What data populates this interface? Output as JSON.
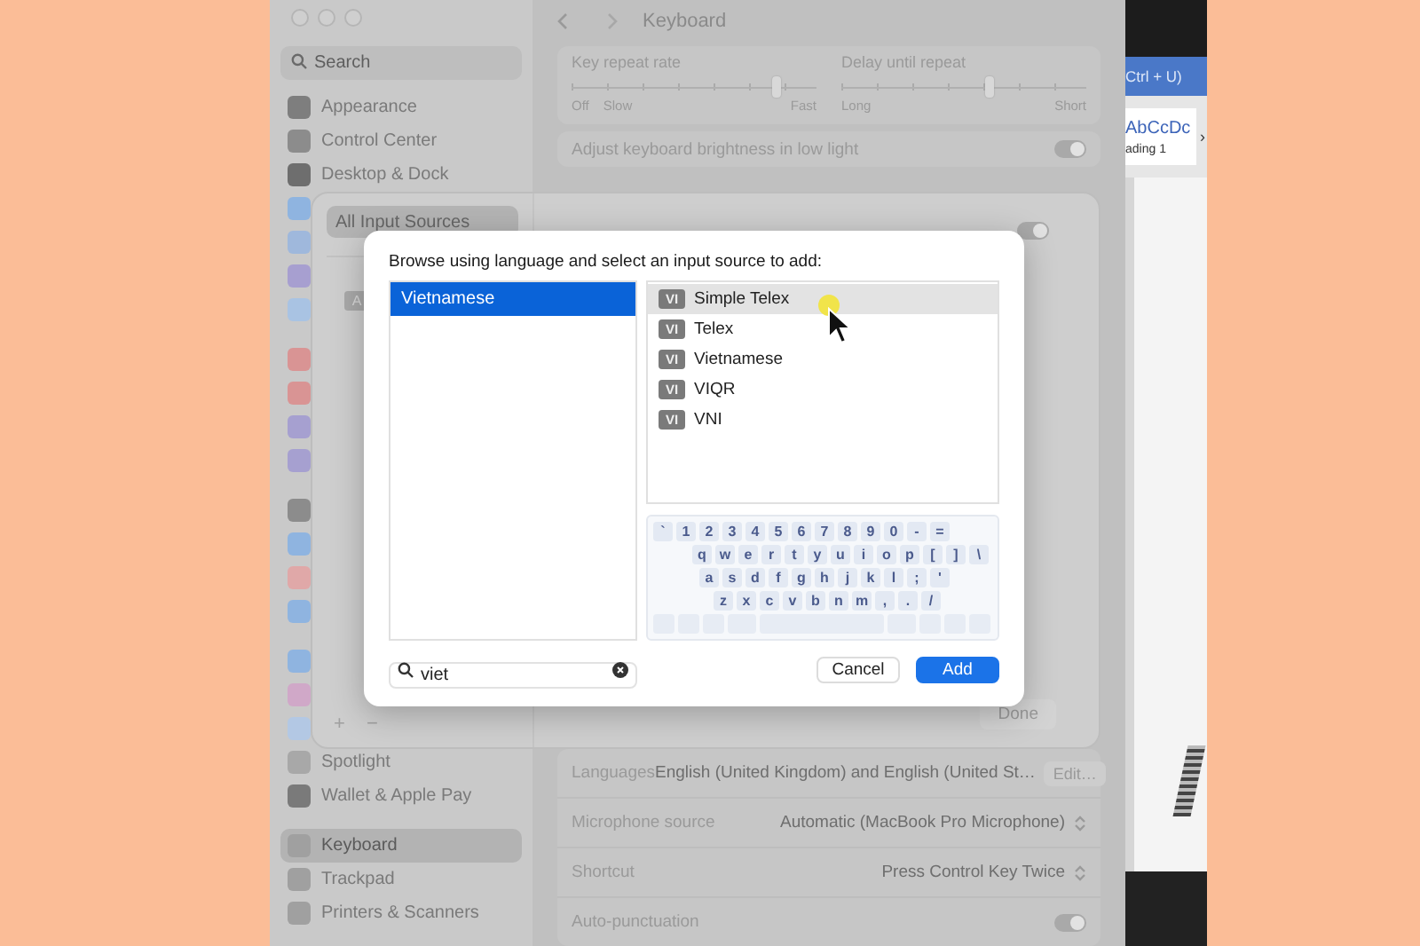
{
  "sidebar": {
    "search": {
      "placeholder": "Search"
    },
    "groups": [
      [
        {
          "label": "Appearance",
          "color": "#7e7e7e",
          "selected": false
        },
        {
          "label": "Control Center",
          "color": "#8c8c8c",
          "selected": false
        },
        {
          "label": "Desktop & Dock",
          "color": "#6e6e6e",
          "selected": false
        },
        {
          "color": "#8fb4e0",
          "selected": false
        },
        {
          "color": "#9fb8dc",
          "selected": false
        },
        {
          "color": "#a79fd0",
          "selected": false
        },
        {
          "color": "#a9c3e3",
          "selected": false
        }
      ],
      [
        {
          "color": "#d99494",
          "selected": false
        },
        {
          "color": "#d99494",
          "selected": false
        },
        {
          "color": "#a6a0d0",
          "selected": false
        },
        {
          "color": "#a6a0d0",
          "selected": false
        }
      ],
      [
        {
          "color": "#8c8c8c",
          "selected": false
        },
        {
          "color": "#8fb4e0",
          "selected": false
        },
        {
          "color": "#e0a8a8",
          "selected": false
        },
        {
          "color": "#8fb4e0",
          "selected": false
        }
      ],
      [
        {
          "color": "#8fb4e0",
          "selected": false
        },
        {
          "color": "#d0a8c8",
          "selected": false
        },
        {
          "color": "#b3c8e4",
          "selected": false
        },
        {
          "label": "Spotlight",
          "color": "#a8a8a8",
          "selected": false
        },
        {
          "label": "Wallet & Apple Pay",
          "color": "#7a7a7a",
          "selected": false
        }
      ],
      [
        {
          "label": "Keyboard",
          "color": "#a0a0a0",
          "selected": true
        },
        {
          "label": "Trackpad",
          "color": "#a0a0a0",
          "selected": false
        },
        {
          "label": "Printers & Scanners",
          "color": "#a0a0a0",
          "selected": false
        }
      ]
    ]
  },
  "header": {
    "title": "Keyboard"
  },
  "sliders": [
    {
      "label": "Key repeat rate",
      "level": 0.83,
      "marks": [
        "Off",
        "Slow",
        "Fast"
      ]
    },
    {
      "label": "Delay until repeat",
      "level": 0.6,
      "marks": [
        "Long",
        "Short"
      ]
    }
  ],
  "brightness": {
    "label": "Adjust keyboard brightness in low light",
    "on": true
  },
  "settings": [
    {
      "kind": "languages",
      "label": "Languages",
      "value": "English (United Kingdom) and English (United St…",
      "button": "Edit…"
    },
    {
      "kind": "popup",
      "label": "Microphone source",
      "value": "Automatic (MacBook Pro Microphone)"
    },
    {
      "kind": "popup",
      "label": "Shortcut",
      "value": "Press Control Key Twice"
    },
    {
      "kind": "toggle",
      "label": "Auto-punctuation",
      "on": true
    }
  ],
  "sheet": {
    "sources": [
      {
        "label": "All Input Sources",
        "selected": true
      }
    ],
    "badge": "A",
    "menu_toggle": {
      "on": true
    },
    "add": "+",
    "remove": "−",
    "done": "Done"
  },
  "dialog": {
    "prompt": "Browse using language and select an input source to add:",
    "languages": [
      {
        "label": "Vietnamese",
        "selected": true
      }
    ],
    "sources": [
      {
        "badge": "VI",
        "label": "Simple Telex",
        "selected": true
      },
      {
        "badge": "VI",
        "label": "Telex",
        "selected": false
      },
      {
        "badge": "VI",
        "label": "Vietnamese",
        "selected": false
      },
      {
        "badge": "VI",
        "label": "VIQR",
        "selected": false
      },
      {
        "badge": "VI",
        "label": "VNI",
        "selected": false
      }
    ],
    "keyboard": {
      "rows": [
        [
          "`",
          "1",
          "2",
          "3",
          "4",
          "5",
          "6",
          "7",
          "8",
          "9",
          "0",
          "-",
          "="
        ],
        [
          "q",
          "w",
          "e",
          "r",
          "t",
          "y",
          "u",
          "i",
          "o",
          "p",
          "[",
          "]",
          "\\"
        ],
        [
          "a",
          "s",
          "d",
          "f",
          "g",
          "h",
          "j",
          "k",
          "l",
          ";",
          "'"
        ],
        [
          "z",
          "x",
          "c",
          "v",
          "b",
          "n",
          "m",
          ",",
          ".",
          "/"
        ]
      ]
    },
    "search": {
      "value": "viet"
    },
    "buttons": [
      {
        "label": "Cancel",
        "kind": "secondary"
      },
      {
        "label": "Add",
        "kind": "primary"
      }
    ]
  },
  "document": {
    "shortcut": "Ctrl + U)",
    "style_sample": "AbCcDc",
    "style_name": "ading 1",
    "more": "›"
  }
}
